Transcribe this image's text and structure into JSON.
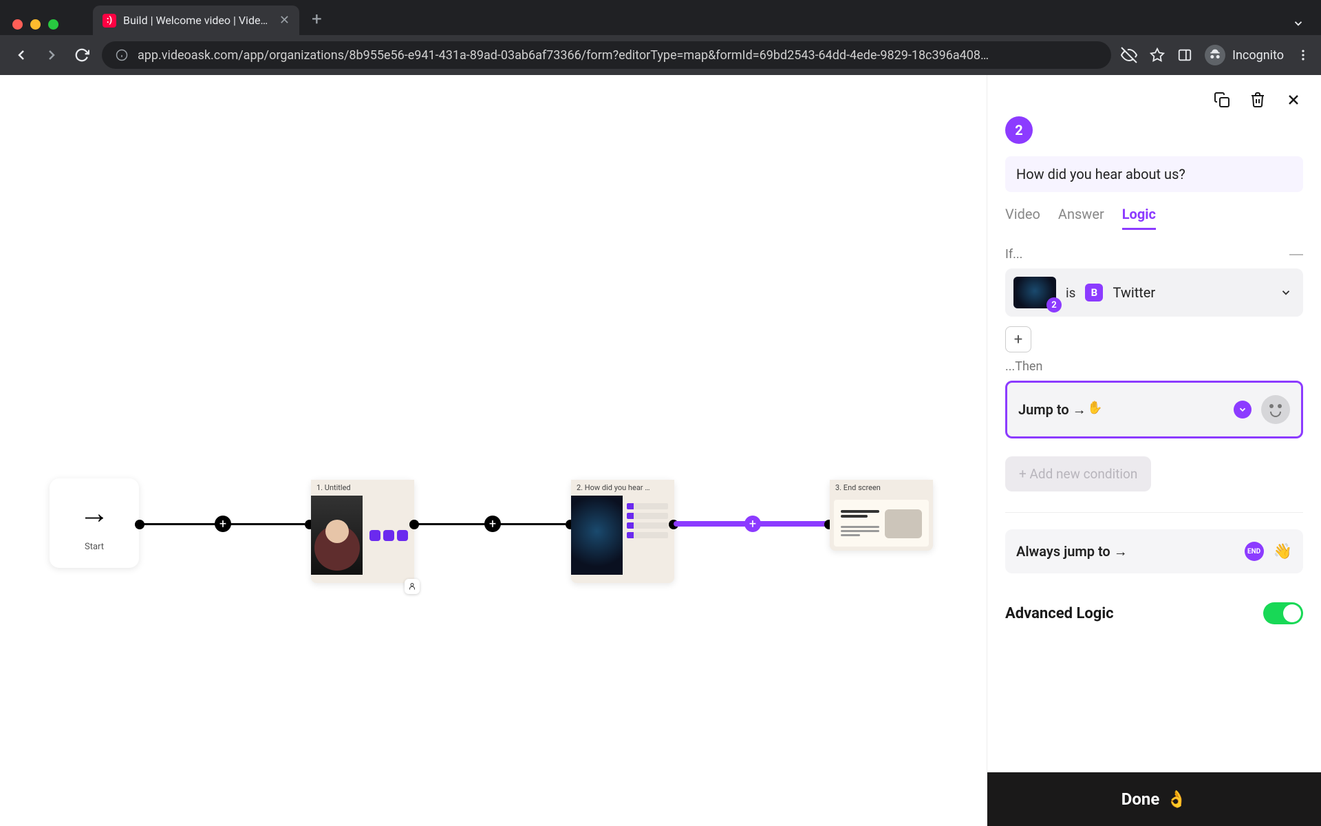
{
  "browser": {
    "tab_title": "Build | Welcome video | VideoA…",
    "url": "app.videoask.com/app/organizations/8b955e56-e941-431a-89ad-03ab6af73366/form?editorType=map&formId=69bd2543-64dd-4ede-9829-18c396a408…",
    "profile_label": "Incognito"
  },
  "canvas": {
    "start_label": "Start",
    "nodes": {
      "0": {
        "label": "1. Untitled"
      },
      "1": {
        "label": "2. How did you hear …"
      },
      "2": {
        "label": "3. End screen"
      }
    }
  },
  "sidebar": {
    "step_number": "2",
    "question": "How did you hear about us?",
    "tabs": {
      "video": "Video",
      "answer": "Answer",
      "logic": "Logic"
    },
    "if_label": "If...",
    "cond_step_badge": "2",
    "cond_is": "is",
    "cond_choice_letter": "B",
    "cond_choice_value": "Twitter",
    "then_label": "...Then",
    "jump_label": "Jump to →",
    "add_condition_label": "+ Add new condition",
    "always_label": "Always jump to →",
    "always_end_badge": "END",
    "always_emoji": "👋",
    "advanced_label": "Advanced Logic",
    "done_label": "Done",
    "done_emoji": "👌"
  }
}
